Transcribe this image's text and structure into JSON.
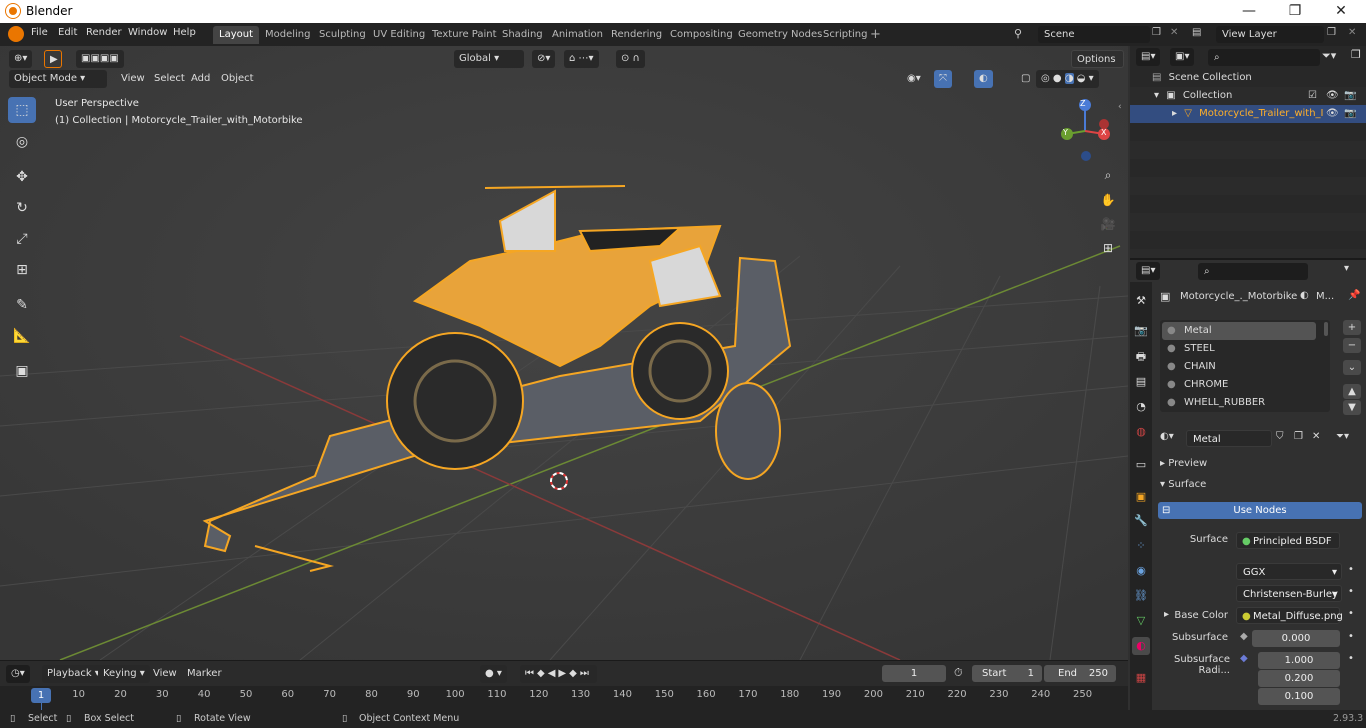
{
  "window": {
    "title": "Blender",
    "min": "—",
    "max": "❐",
    "close": "✕"
  },
  "menu": [
    "File",
    "Edit",
    "Render",
    "Window",
    "Help"
  ],
  "workspaces": [
    "Layout",
    "Modeling",
    "Sculpting",
    "UV Editing",
    "Texture Paint",
    "Shading",
    "Animation",
    "Rendering",
    "Compositing",
    "Geometry Nodes",
    "Scripting"
  ],
  "scene": {
    "name": "Scene",
    "view_layer": "View Layer"
  },
  "viewport": {
    "mode": "Object Mode",
    "menus": [
      "View",
      "Select",
      "Add",
      "Object"
    ],
    "orientation": "Global",
    "options": "Options",
    "perspective": "User Perspective",
    "collection_info": "(1) Collection | Motorcycle_Trailer_with_Motorbike",
    "gizmo": {
      "x": "X",
      "y": "Y",
      "z": "Z"
    }
  },
  "timeline": {
    "menus": [
      "Playback",
      "Keying",
      "View",
      "Marker"
    ],
    "current_frame": "1",
    "start_label": "Start",
    "start": "1",
    "end_label": "End",
    "end": "250",
    "ruler": [
      "1",
      "10",
      "20",
      "30",
      "40",
      "50",
      "60",
      "70",
      "80",
      "90",
      "100",
      "110",
      "120",
      "130",
      "140",
      "150",
      "160",
      "170",
      "180",
      "190",
      "200",
      "210",
      "220",
      "230",
      "240",
      "250"
    ]
  },
  "status": {
    "select": "Select",
    "box_select": "Box Select",
    "rotate": "Rotate View",
    "context": "Object Context Menu",
    "version": "2.93.3"
  },
  "outliner": {
    "scene_collection": "Scene Collection",
    "collection": "Collection",
    "object": "Motorcycle_Trailer_with_I"
  },
  "properties": {
    "object_name": "Motorcycle_._Motorbike",
    "material_short": "M...",
    "slots": [
      "Metal",
      "STEEL",
      "CHAIN",
      "CHROME",
      "WHELL_RUBBER"
    ],
    "material": "Metal",
    "preview": "Preview",
    "surface_panel": "Surface",
    "use_nodes": "Use Nodes",
    "surface_label": "Surface",
    "surface_value": "Principled BSDF",
    "distribution": "GGX",
    "sss_method": "Christensen-Burley",
    "base_color_label": "Base Color",
    "base_color_value": "Metal_Diffuse.png",
    "subsurface_label": "Subsurface",
    "subsurface_value": "0.000",
    "sss_radius_label": "Subsurface Radi...",
    "sss_radius": [
      "1.000",
      "0.200",
      "0.100"
    ]
  },
  "colors": {
    "accent": "#4772b3",
    "selection": "#f5a623",
    "object_text": "#ffaf29"
  }
}
